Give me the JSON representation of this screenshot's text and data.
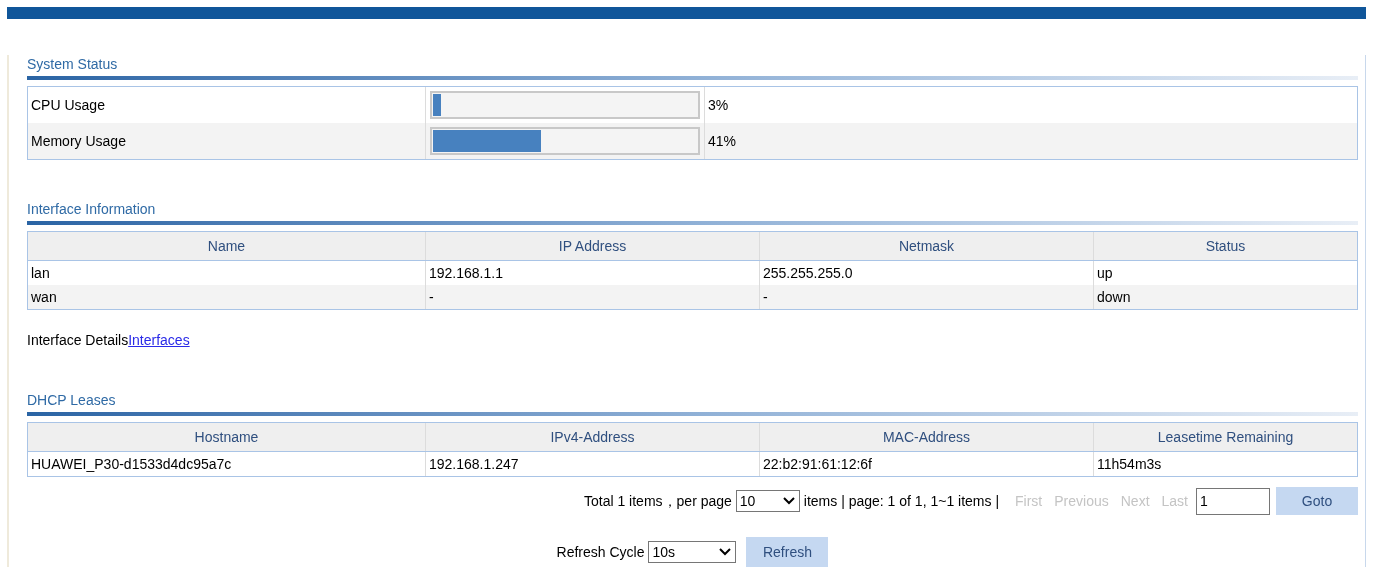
{
  "system_status": {
    "title": "System Status",
    "rows": [
      {
        "label": "CPU Usage",
        "level": 0.03,
        "reading": "3%"
      },
      {
        "label": "Memory Usage",
        "level": 0.41,
        "reading": "41%"
      }
    ]
  },
  "interfaces": {
    "title": "Interface Information",
    "columns": [
      "Name",
      "IP Address",
      "Netmask",
      "Status"
    ],
    "rows": [
      [
        "lan",
        "192.168.1.1",
        "255.255.255.0",
        "up"
      ],
      [
        "wan",
        "-",
        "-",
        "down"
      ]
    ]
  },
  "interface_details": {
    "label": "Interface Details",
    "link": "Interfaces"
  },
  "dhcp": {
    "title": "DHCP Leases",
    "columns": [
      "Hostname",
      "IPv4-Address",
      "MAC-Address",
      "Leasetime Remaining"
    ],
    "rows": [
      [
        "HUAWEI_P30-d1533d4dc95a7c",
        "192.168.1.247",
        "22:b2:91:61:12:6f",
        "11h54m3s"
      ]
    ]
  },
  "pagination": {
    "total": "Total 1 items，per page",
    "per_page": "10",
    "info": "items | page: 1 of 1, 1~1 items |",
    "links": [
      {
        "label": "First",
        "disabled": true
      },
      {
        "label": "Previous",
        "disabled": true
      },
      {
        "label": "Next",
        "disabled": true
      },
      {
        "label": "Last",
        "disabled": true
      }
    ],
    "page_value": "1",
    "goto": "Goto"
  },
  "refresh": {
    "label": "Refresh Cycle",
    "value": "10s",
    "button": "Refresh"
  }
}
